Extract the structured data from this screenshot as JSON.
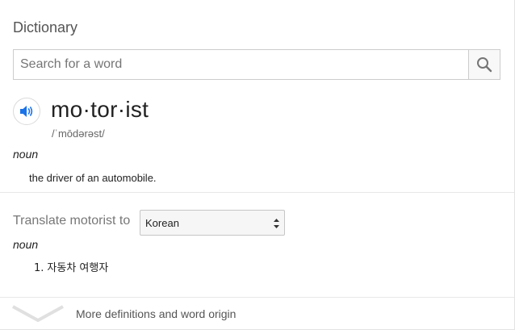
{
  "dictionary": {
    "title": "Dictionary",
    "search": {
      "placeholder": "Search for a word",
      "value": ""
    },
    "entry": {
      "headword": "mo·tor·ist",
      "pronunciation": "/ˈmōdərəst/",
      "part_of_speech": "noun",
      "definition": "the driver of an automobile."
    },
    "translate": {
      "label": "Translate motorist to",
      "selected_language": "Korean",
      "part_of_speech": "noun",
      "items": [
        {
          "number": "1.",
          "text": "자동차 여행자"
        }
      ]
    },
    "more_link": "More definitions and word origin",
    "icons": {
      "search": "search-icon",
      "speaker": "speaker-icon",
      "dropdown": "select-arrows-icon",
      "expand": "chevron-down-icon"
    },
    "colors": {
      "speaker_blue": "#1a73e8",
      "search_icon": "#757575"
    }
  }
}
